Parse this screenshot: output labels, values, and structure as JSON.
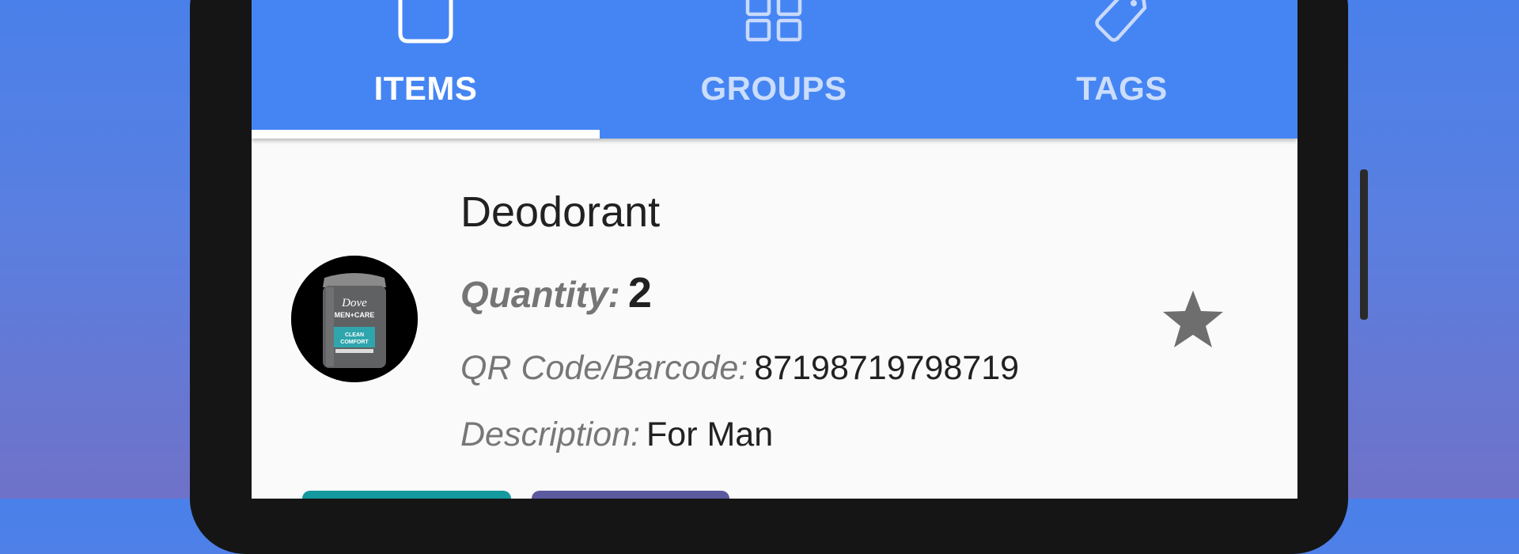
{
  "colors": {
    "tab_bar": "#4585f3",
    "active_tab": "#ffffff",
    "inactive_tab": "#c9d9fb",
    "star": "#6e6e6e",
    "chip_1": "#13999e",
    "chip_2": "#5c5a9e"
  },
  "tabs": [
    {
      "label": "ITEMS",
      "icon": "item-icon",
      "active": true
    },
    {
      "label": "GROUPS",
      "icon": "grid-icon",
      "active": false
    },
    {
      "label": "TAGS",
      "icon": "tag-icon",
      "active": false
    }
  ],
  "item": {
    "name": "Deodorant",
    "thumbnail": "deodorant-product-image",
    "quantity_label": "Quantity:",
    "quantity_value": "2",
    "code_label": "QR Code/Barcode:",
    "code_value": "87198719798719",
    "description_label": "Description:",
    "description_value": "For Man",
    "favorite_icon": "star-icon",
    "product_brand_text": "Dove MEN+CARE CLEAN COMFORT"
  }
}
